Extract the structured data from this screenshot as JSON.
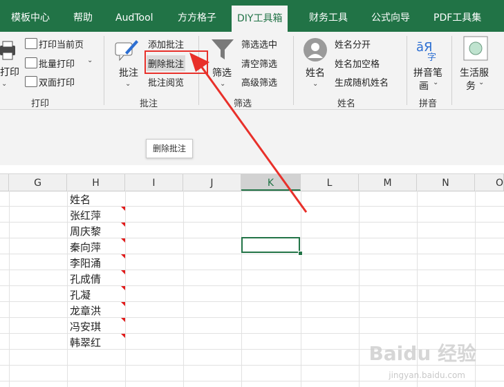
{
  "tabs": [
    "模板中心",
    "帮助",
    "AudTool",
    "方方格子",
    "DIY工具箱",
    "财务工具",
    "公式向导",
    "PDF工具集"
  ],
  "ribbon": {
    "print": {
      "big": "打印",
      "items": [
        "打印当前页",
        "批量打印",
        "双面打印"
      ],
      "group": "打印"
    },
    "comment": {
      "big": "批注",
      "items": [
        "添加批注",
        "删除批注",
        "批注阅览"
      ],
      "group": "批注"
    },
    "filter": {
      "big": "筛选",
      "items": [
        "筛选选中",
        "清空筛选",
        "高级筛选"
      ],
      "group": "筛选"
    },
    "name": {
      "big": "姓名",
      "items": [
        "姓名分开",
        "姓名加空格",
        "生成随机姓名"
      ],
      "group": "姓名"
    },
    "pinyin": {
      "big_line1": "拼音笔",
      "big_line2": "画",
      "glyph_top": "āЯ",
      "glyph_bottom": "字",
      "group": "拼音"
    },
    "life": {
      "big_line1": "生活服",
      "big_line2": "务"
    }
  },
  "tooltip": "删除批注",
  "columns": [
    "G",
    "H",
    "I",
    "J",
    "K",
    "L",
    "M",
    "N",
    "O"
  ],
  "selected_column": "K",
  "names": [
    "姓名",
    "张红萍",
    "周庆黎",
    "秦向萍",
    "李阳涌",
    "孔成倩",
    "孔凝",
    "龙章洪",
    "冯安琪",
    "韩翠红"
  ],
  "watermark": {
    "main": "Baidu 经验",
    "sub": "jingyan.baidu.com"
  },
  "colors": {
    "accent": "#217346",
    "highlight": "#e8302a",
    "comment_marker": "#e21b1b"
  }
}
